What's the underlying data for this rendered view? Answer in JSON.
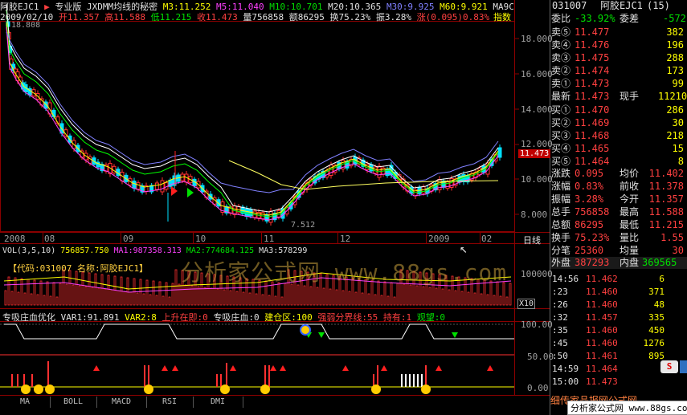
{
  "header": {
    "symbol": "阿胶EJC1",
    "mode": "专业版",
    "indicator": "JXDMM均线的秘密",
    "ma3": "M3:11.252",
    "ma5": "M5:11.040",
    "ma10": "M10:10.701",
    "ma20": "M20:10.365",
    "ma30": "M30:9.925",
    "ma60": "M60:9.921",
    "ma90": "MA9C",
    "index_label": "指数"
  },
  "info": {
    "date": "2009/02/10",
    "open": "开11.357",
    "high": "高11.588",
    "low": "低11.215",
    "close": "收11.473",
    "volume": "量756858",
    "amount": "额86295",
    "turnover": "换75.23%",
    "amplitude": "振3.28%",
    "change": "涨(0.095)0.83%"
  },
  "main_chart": {
    "y_ticks": [
      "18.000",
      "16.000",
      "14.000",
      "12.000",
      "10.000",
      "8.000"
    ],
    "high_label": "18.808",
    "low_label": "7.512",
    "last_label": "11.473",
    "x_labels": [
      "2008",
      "08",
      "09",
      "10",
      "11",
      "12",
      "2009",
      "02"
    ],
    "period_label": "日线"
  },
  "vol_panel": {
    "title": "VOL(3,5,10)",
    "vol": "756857.750",
    "ma1": "MA1:987358.313",
    "ma2": "MA2:774684.125",
    "ma3": "MA3:578299",
    "code_box": "【代码:031007 名称:阿胶EJC1】",
    "y_tick": "100000",
    "unit": "X10"
  },
  "ind_panel": {
    "title": "专吸庄血优化",
    "var1": "VAR1:91.891",
    "var2": "VAR2:8",
    "up": "上升在即:0",
    "blood": "专吸庄血:0",
    "build": "建仓区:100",
    "strong": "强弱分界线:55",
    "hold": "持有:1",
    "watch": "观望:0",
    "y_ticks": [
      "100.00",
      "50.00",
      "0.00"
    ]
  },
  "tabs": [
    "MA",
    "BOLL",
    "MACD",
    "RSI",
    "DMI"
  ],
  "watermark": "分析家公式网 www.88gs.com",
  "quote": {
    "title": "阿胶EJC1",
    "code": "031007",
    "period": "(15)",
    "weibi_label": "委比",
    "weibi": "-33.92%",
    "weicha_label": "委差",
    "weicha": "-572",
    "asks": [
      {
        "label": "卖⑤",
        "price": "11.477",
        "vol": "382"
      },
      {
        "label": "卖④",
        "price": "11.476",
        "vol": "196"
      },
      {
        "label": "卖③",
        "price": "11.475",
        "vol": "288"
      },
      {
        "label": "卖②",
        "price": "11.474",
        "vol": "173"
      },
      {
        "label": "卖①",
        "price": "11.473",
        "vol": "99"
      }
    ],
    "last_label": "最新",
    "last": "11.473",
    "hand_label": "现手",
    "hand": "11210",
    "bids": [
      {
        "label": "买①",
        "price": "11.470",
        "vol": "286"
      },
      {
        "label": "买②",
        "price": "11.469",
        "vol": "30"
      },
      {
        "label": "买③",
        "price": "11.468",
        "vol": "218"
      },
      {
        "label": "买④",
        "price": "11.465",
        "vol": "15"
      },
      {
        "label": "买⑤",
        "price": "11.464",
        "vol": "8"
      }
    ],
    "stats": [
      {
        "l1": "涨跌",
        "v1": "0.095",
        "l2": "均价",
        "v2": "11.402"
      },
      {
        "l1": "涨幅",
        "v1": "0.83%",
        "l2": "前收",
        "v2": "11.378"
      },
      {
        "l1": "振幅",
        "v1": "3.28%",
        "l2": "今开",
        "v2": "11.357"
      },
      {
        "l1": "总手",
        "v1": "756858",
        "l2": "最高",
        "v2": "11.588"
      },
      {
        "l1": "总额",
        "v1": "86295",
        "l2": "最低",
        "v2": "11.215"
      },
      {
        "l1": "换手",
        "v1": "75.23%",
        "l2": "量比",
        "v2": "1.55"
      },
      {
        "l1": "分笔",
        "v1": "25360",
        "l2": "均量",
        "v2": "30"
      }
    ],
    "outer_label": "外盘",
    "outer": "387293",
    "inner_label": "内盘",
    "inner": "369565",
    "ticks": [
      {
        "time": "14:56",
        "price": "11.462",
        "vol": "6"
      },
      {
        "time": ":23",
        "price": "11.460",
        "vol": "371"
      },
      {
        "time": ":26",
        "price": "11.460",
        "vol": "48"
      },
      {
        "time": ":32",
        "price": "11.457",
        "vol": "335"
      },
      {
        "time": ":35",
        "price": "11.460",
        "vol": "450"
      },
      {
        "time": ":45",
        "price": "11.460",
        "vol": "1276"
      },
      {
        "time": ":50",
        "price": "11.461",
        "vol": "895"
      },
      {
        "time": "14:59",
        "price": "11.464",
        "vol": ""
      },
      {
        "time": "15:00",
        "price": "11.473",
        "vol": ""
      }
    ],
    "bottom_text": "细传家品报网公式网"
  },
  "bottom_badge": "分析家公式网 www.88gs.com",
  "colors": {
    "up": "#ff4040",
    "down": "#00ffff",
    "grid": "#8b0000",
    "ma_yellow": "#ffff00",
    "ma_green": "#00ff00"
  }
}
